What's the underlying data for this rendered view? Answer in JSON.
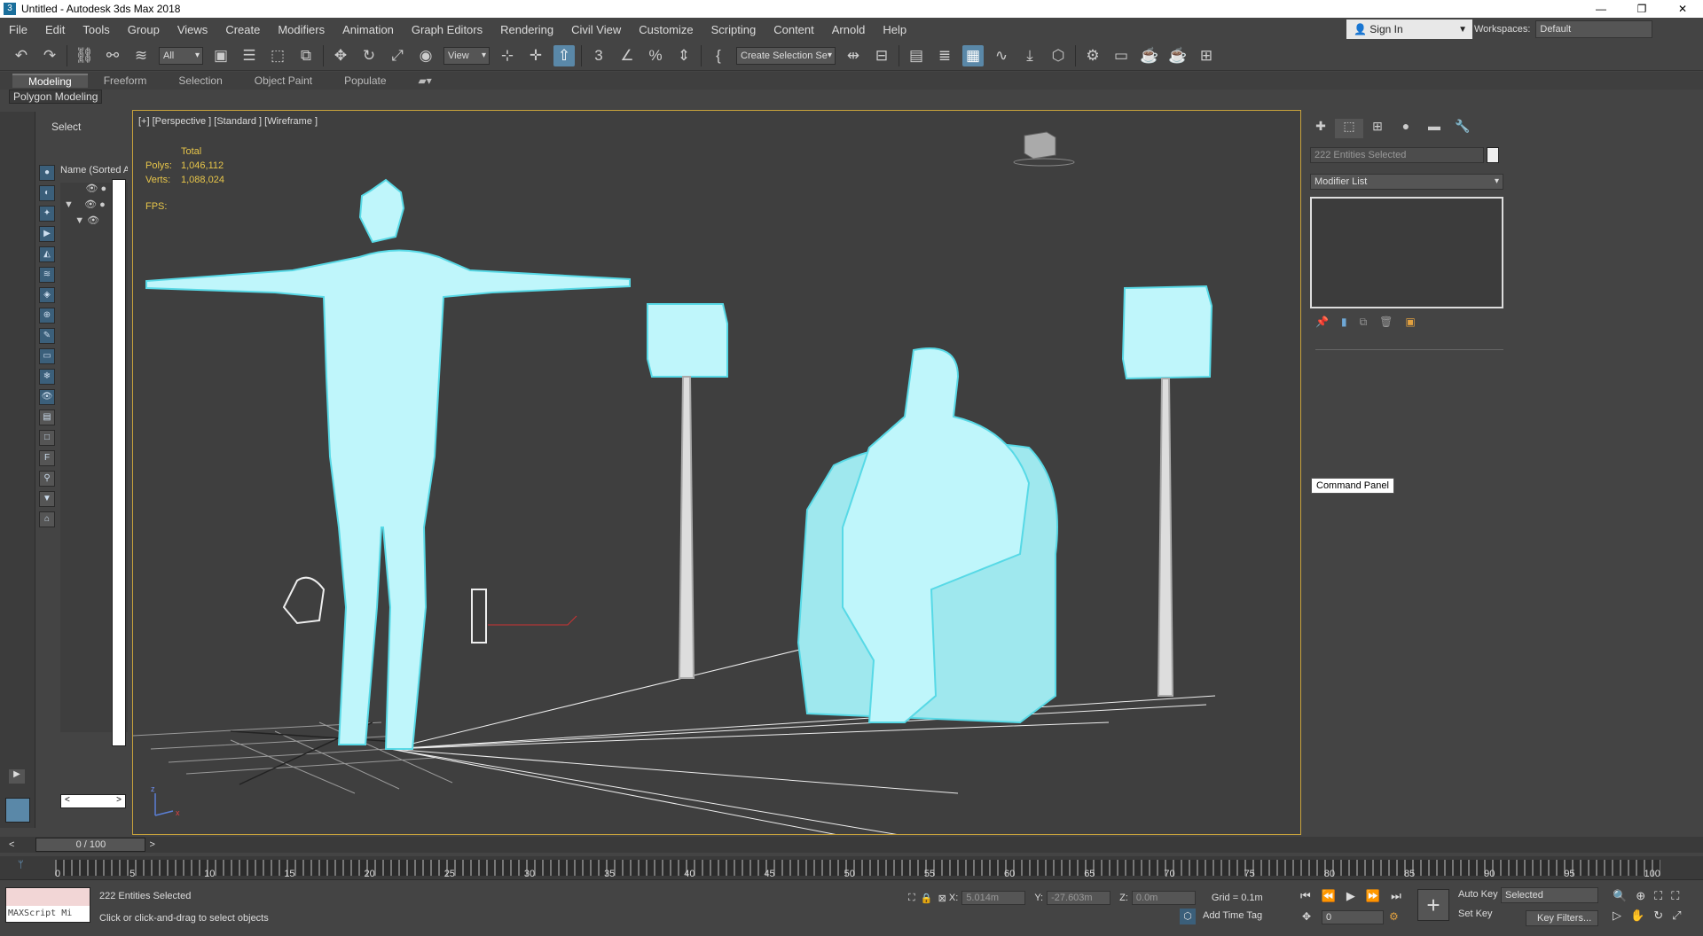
{
  "window": {
    "title": "Untitled - Autodesk 3ds Max 2018",
    "controls": [
      "—",
      "❐",
      "✕"
    ]
  },
  "menu": [
    "File",
    "Edit",
    "Tools",
    "Group",
    "Views",
    "Create",
    "Modifiers",
    "Animation",
    "Graph Editors",
    "Rendering",
    "Civil View",
    "Customize",
    "Scripting",
    "Content",
    "Arnold",
    "Help"
  ],
  "signin": {
    "label": "Sign In"
  },
  "workspace": {
    "label": "Workspaces:",
    "value": "Default"
  },
  "toolbar": {
    "filter_value": "All",
    "coord_value": "View",
    "selection_set": "Create Selection Se"
  },
  "ribbon": {
    "tabs": [
      "Modeling",
      "Freeform",
      "Selection",
      "Object Paint",
      "Populate"
    ],
    "subtitle": "Polygon Modeling"
  },
  "scene_explorer": {
    "select_label": "Select",
    "column_header": "Name (Sorted A"
  },
  "viewport": {
    "label": "[+] [Perspective ] [Standard ] [Wireframe ]",
    "stats": {
      "total_label": "Total",
      "polys_label": "Polys:",
      "polys_value": "1,046,112",
      "verts_label": "Verts:",
      "verts_value": "1,088,024",
      "fps_label": "FPS:"
    },
    "wire_color": "#8ff0f8",
    "frame_color": "#c8a23c"
  },
  "command_panel": {
    "entities": "222 Entities Selected",
    "modifier_list": "Modifier List",
    "tooltip": "Command Panel"
  },
  "timeline": {
    "slider": "0 / 100",
    "ticks": [
      "0",
      "5",
      "10",
      "15",
      "20",
      "25",
      "30",
      "35",
      "40",
      "45",
      "50",
      "55",
      "60",
      "65",
      "70",
      "75",
      "80",
      "85",
      "90",
      "95",
      "100"
    ]
  },
  "status": {
    "maxscript": "MAXScript Mi",
    "line1": "222 Entities Selected",
    "line2": "Click or click-and-drag to select objects",
    "x_label": "X:",
    "x_value": "5.014m",
    "y_label": "Y:",
    "y_value": "-27.603m",
    "z_label": "Z:",
    "z_value": "0.0m",
    "grid": "Grid = 0.1m",
    "add_time_tag": "Add Time Tag",
    "auto_key": "Auto Key",
    "set_key": "Set Key",
    "selected": "Selected",
    "key_filters": "Key Filters...",
    "frame": "0"
  }
}
